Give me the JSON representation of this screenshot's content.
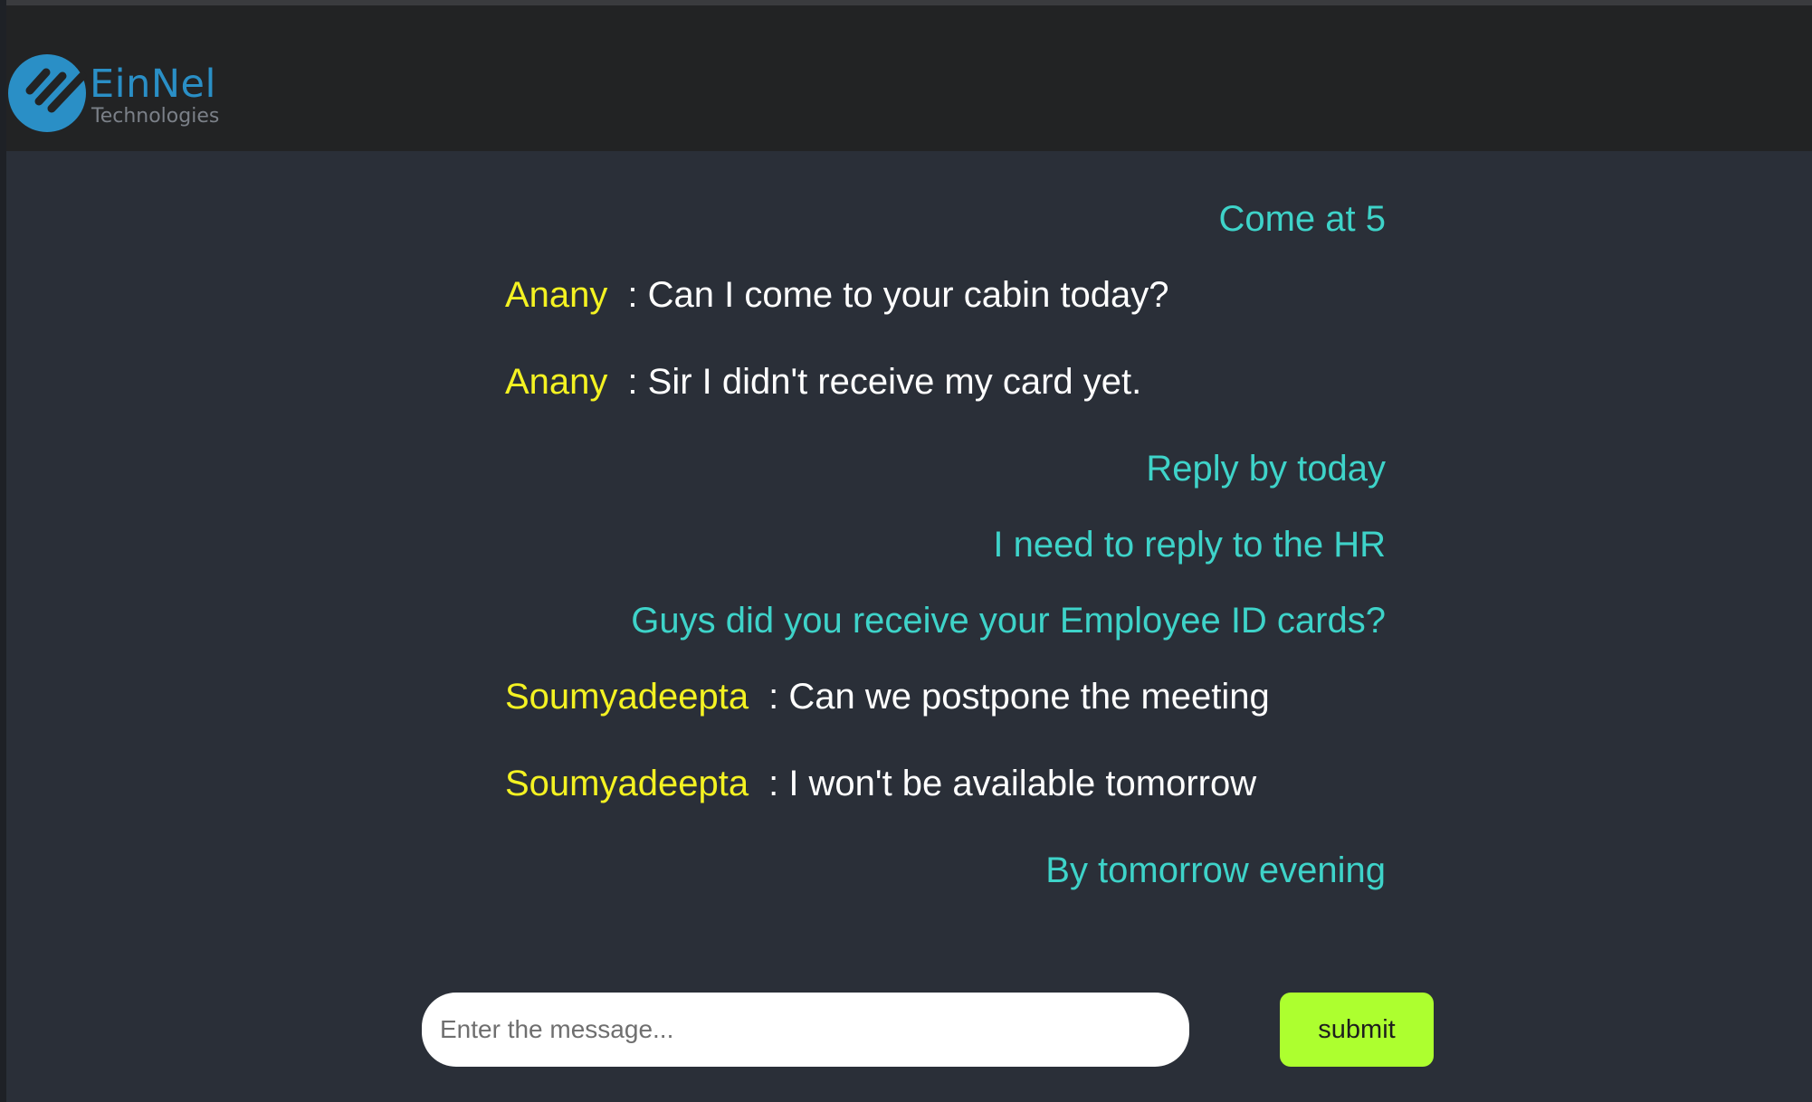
{
  "header": {
    "logo_name": "EinNel",
    "logo_subtitle": "Technologies",
    "brand_color": "#2a8fc6",
    "background": "#222324"
  },
  "messages": [
    {
      "type": "own",
      "text": "Come at 5"
    },
    {
      "type": "other",
      "sender": "Anany",
      "text": ": Can I come to your cabin today?"
    },
    {
      "type": "other",
      "sender": "Anany",
      "text": ": Sir I didn't receive my card yet."
    },
    {
      "type": "own",
      "text": "Reply by today"
    },
    {
      "type": "own",
      "text": "I need to reply to the HR"
    },
    {
      "type": "own",
      "text": "Guys did you receive your Employee ID cards?"
    },
    {
      "type": "other",
      "sender": "Soumyadeepta",
      "text": ": Can we postpone the meeting"
    },
    {
      "type": "other",
      "sender": "Soumyadeepta",
      "text": ": I won't be available tomorrow"
    },
    {
      "type": "own",
      "text": "By tomorrow evening"
    }
  ],
  "composer": {
    "placeholder": "Enter the message...",
    "value": ""
  },
  "submit_label": "submit",
  "colors": {
    "own_message": "#3ed3c9",
    "sender_name": "#f4f222",
    "other_message": "#ffffff",
    "submit_button": "#adff2f",
    "page_background": "#2a2f38"
  }
}
